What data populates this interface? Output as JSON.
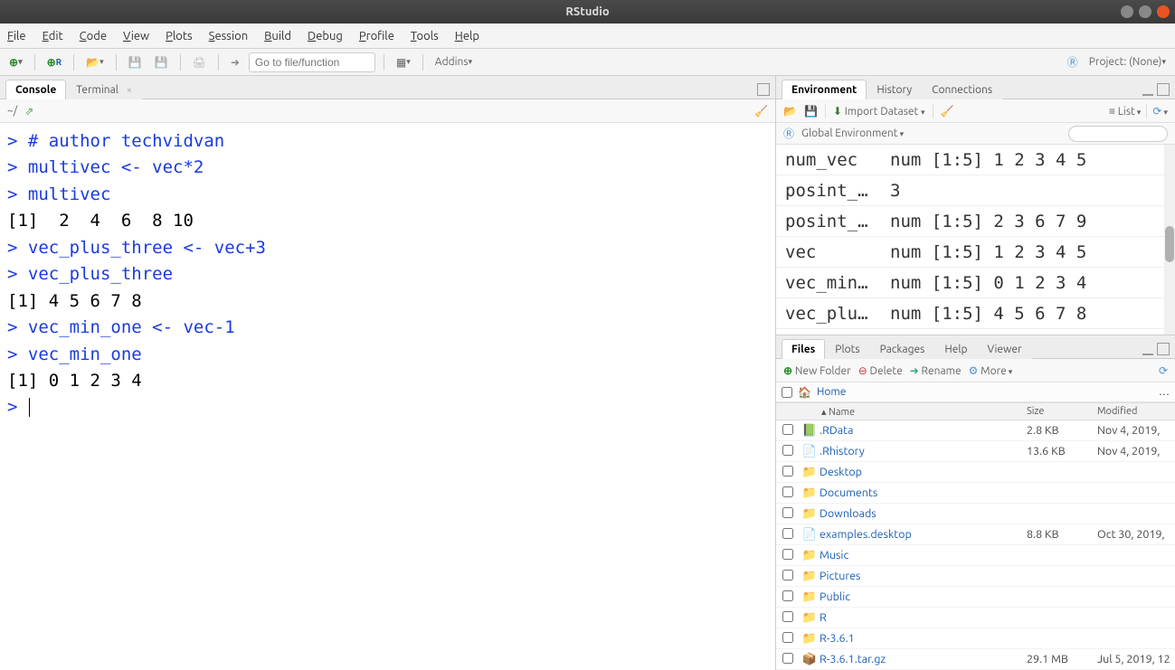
{
  "window": {
    "title": "RStudio"
  },
  "menu": [
    "File",
    "Edit",
    "Code",
    "View",
    "Plots",
    "Session",
    "Build",
    "Debug",
    "Profile",
    "Tools",
    "Help"
  ],
  "toolbar": {
    "goto_placeholder": "Go to file/function",
    "addins": "Addins",
    "project": "Project: (None)"
  },
  "left": {
    "tabs": {
      "console": "Console",
      "terminal": "Terminal"
    },
    "path": "~/",
    "lines": [
      {
        "t": "cmd",
        "s": "> # author techvidvan"
      },
      {
        "t": "cmd",
        "s": "> multivec <- vec*2"
      },
      {
        "t": "cmd",
        "s": "> multivec"
      },
      {
        "t": "out",
        "s": "[1]  2  4  6  8 10"
      },
      {
        "t": "cmd",
        "s": "> vec_plus_three <- vec+3"
      },
      {
        "t": "cmd",
        "s": "> vec_plus_three"
      },
      {
        "t": "out",
        "s": "[1] 4 5 6 7 8"
      },
      {
        "t": "cmd",
        "s": "> vec_min_one <- vec-1"
      },
      {
        "t": "cmd",
        "s": "> vec_min_one"
      },
      {
        "t": "out",
        "s": "[1] 0 1 2 3 4"
      },
      {
        "t": "cmd",
        "s": "> "
      }
    ]
  },
  "env": {
    "tabs": {
      "environment": "Environment",
      "history": "History",
      "connections": "Connections"
    },
    "import": "Import Dataset",
    "view": "List",
    "scope": "Global Environment",
    "rows": [
      {
        "n": "num_vec",
        "v": "num [1:5] 1 2 3 4 5"
      },
      {
        "n": "posint_…",
        "v": "3"
      },
      {
        "n": "posint_…",
        "v": "num [1:5] 2 3 6 7 9"
      },
      {
        "n": "vec",
        "v": "num [1:5] 1 2 3 4 5"
      },
      {
        "n": "vec_min…",
        "v": "num [1:5] 0 1 2 3 4"
      },
      {
        "n": "vec_plu…",
        "v": "num [1:5] 4 5 6 7 8"
      }
    ]
  },
  "files": {
    "tabs": {
      "files": "Files",
      "plots": "Plots",
      "packages": "Packages",
      "help": "Help",
      "viewer": "Viewer"
    },
    "actions": {
      "newfolder": "New Folder",
      "delete": "Delete",
      "rename": "Rename",
      "more": "More"
    },
    "home": "Home",
    "cols": {
      "name": "Name",
      "size": "Size",
      "modified": "Modified"
    },
    "rows": [
      {
        "icon": "rdata",
        "name": ".RData",
        "size": "2.8 KB",
        "mod": "Nov 4, 2019,"
      },
      {
        "icon": "file",
        "name": ".Rhistory",
        "size": "13.6 KB",
        "mod": "Nov 4, 2019,"
      },
      {
        "icon": "folder",
        "name": "Desktop",
        "size": "",
        "mod": ""
      },
      {
        "icon": "folder",
        "name": "Documents",
        "size": "",
        "mod": ""
      },
      {
        "icon": "folder",
        "name": "Downloads",
        "size": "",
        "mod": ""
      },
      {
        "icon": "file",
        "name": "examples.desktop",
        "size": "8.8 KB",
        "mod": "Oct 30, 2019,"
      },
      {
        "icon": "folder",
        "name": "Music",
        "size": "",
        "mod": ""
      },
      {
        "icon": "folder",
        "name": "Pictures",
        "size": "",
        "mod": ""
      },
      {
        "icon": "folder",
        "name": "Public",
        "size": "",
        "mod": ""
      },
      {
        "icon": "folder",
        "name": "R",
        "size": "",
        "mod": ""
      },
      {
        "icon": "folder",
        "name": "R-3.6.1",
        "size": "",
        "mod": ""
      },
      {
        "icon": "gz",
        "name": "R-3.6.1.tar.gz",
        "size": "29.1 MB",
        "mod": "Jul 5, 2019, 12"
      }
    ]
  }
}
